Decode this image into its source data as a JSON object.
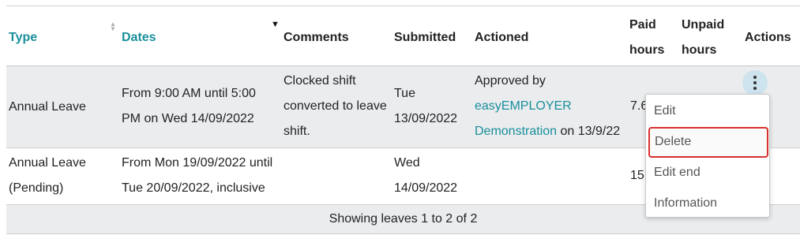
{
  "table": {
    "headers": {
      "type": "Type",
      "dates": "Dates",
      "comments": "Comments",
      "submitted": "Submitted",
      "actioned": "Actioned",
      "paid_hours_line1": "Paid",
      "paid_hours_line2": "hours",
      "unpaid_hours_line1": "Unpaid",
      "unpaid_hours_line2": "hours",
      "actions": "Actions"
    },
    "rows": [
      {
        "type_line1": "Annual Leave",
        "dates_line1": "From 9:00 AM until 5:00",
        "dates_line2": "PM on Wed 14/09/2022",
        "comments_line1": "Clocked shift",
        "comments_line2": "converted to leave",
        "comments_line3": "shift.",
        "submitted_line1": "Tue",
        "submitted_line2": "13/09/2022",
        "actioned_prefix": "Approved by",
        "actioned_link_line1": "easyEMPLOYER",
        "actioned_link_line2": "Demonstration",
        "actioned_suffix": " on 13/9/22",
        "paid_hours": "7.6"
      },
      {
        "type_line1": "Annual Leave",
        "type_line2": "(Pending)",
        "dates_line1": "From Mon 19/09/2022 until",
        "dates_line2": "Tue 20/09/2022, inclusive",
        "submitted_line1": "Wed",
        "submitted_line2": "14/09/2022",
        "paid_hours": "15"
      }
    ],
    "footer": "Showing leaves 1 to 2 of 2"
  },
  "actions_menu": {
    "items": [
      "Edit",
      "Delete",
      "Edit end",
      "Information"
    ],
    "highlighted": "Delete"
  },
  "colors": {
    "accent": "#1a8f9c",
    "highlight_border": "#d9302e",
    "row_shade": "#eaecee"
  }
}
